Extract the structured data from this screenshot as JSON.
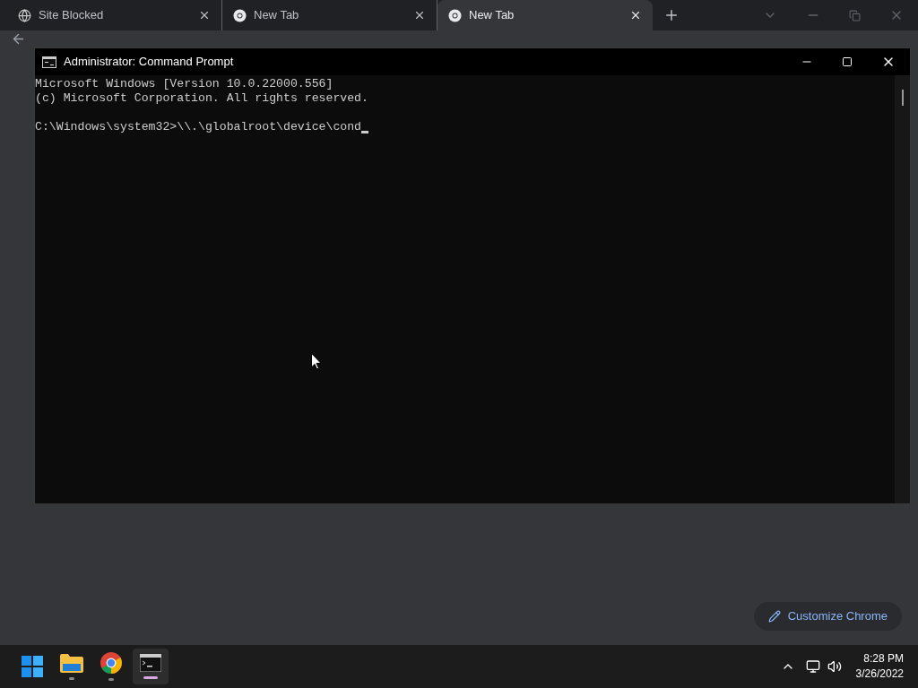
{
  "browser": {
    "tabs": [
      {
        "title": "Site Blocked",
        "kind": "globe",
        "selected": false
      },
      {
        "title": "New Tab",
        "kind": "chrome",
        "selected": false
      },
      {
        "title": "New Tab",
        "kind": "chrome",
        "selected": true
      }
    ],
    "customize_button": "Customize Chrome"
  },
  "console": {
    "title": "Administrator: Command Prompt",
    "lines": [
      "Microsoft Windows [Version 10.0.22000.556]",
      "(c) Microsoft Corporation. All rights reserved."
    ],
    "prompt": "C:\\Windows\\system32>\\\\.\\globalroot\\device\\cond"
  },
  "taskbar": {
    "apps": [
      {
        "kind": "start",
        "selected": false
      },
      {
        "kind": "folder",
        "selected": false
      },
      {
        "kind": "chrome",
        "selected": false
      },
      {
        "kind": "terminal",
        "selected": true
      }
    ],
    "time": "8:28 PM",
    "date": "3/26/2022"
  }
}
